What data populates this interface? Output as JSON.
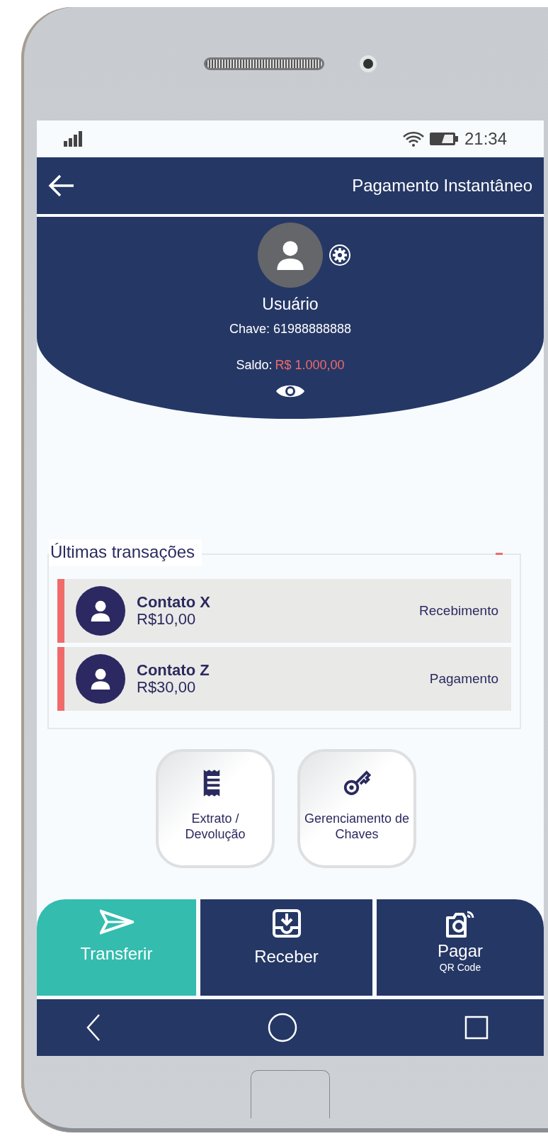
{
  "status_bar": {
    "time": "21:34"
  },
  "header": {
    "title": "Pagamento Instantâneo"
  },
  "profile": {
    "name": "Usuário",
    "key_label": "Chave: 61988888888",
    "balance_label": "Saldo:",
    "balance": "R$ 1.000,00"
  },
  "transactions": {
    "title": "Últimas transações",
    "items": [
      {
        "name": "Contato X",
        "amount": "R$10,00",
        "type": "Recebimento"
      },
      {
        "name": "Contato Z",
        "amount": "R$30,00",
        "type": "Pagamento"
      }
    ]
  },
  "actions": [
    {
      "label": "Extrato / Devolução"
    },
    {
      "label": "Gerenciamento de Chaves"
    }
  ],
  "tabs": [
    {
      "label": "Transferir",
      "selected": true
    },
    {
      "label": "Receber",
      "selected": false
    },
    {
      "label": "Pagar",
      "sublabel": "QR Code",
      "selected": false
    }
  ]
}
